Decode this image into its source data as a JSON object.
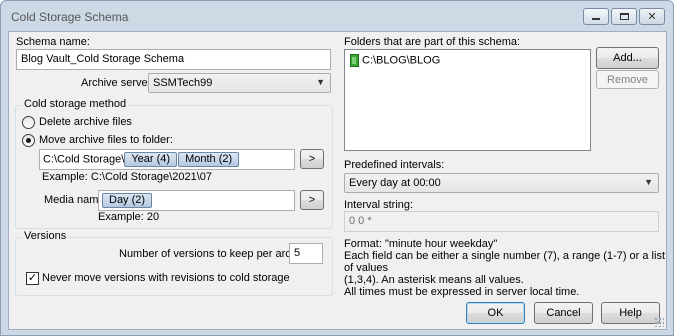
{
  "window": {
    "title": "Cold Storage Schema",
    "minimize_icon": "minimize-icon",
    "maximize_icon": "maximize-icon",
    "close_icon": "close-icon"
  },
  "schema_name": {
    "label": "Schema name:",
    "value": "Blog Vault_Cold Storage Schema"
  },
  "archive_server": {
    "label": "Archive server:",
    "value": "SSMTech99"
  },
  "cold_storage_method": {
    "title": "Cold storage method",
    "option_delete": "Delete archive files",
    "option_move": "Move archive files to folder:",
    "selected": "move",
    "folder_prefix": "C:\\Cold Storage\\",
    "folder_tokens": [
      "Year (4)",
      "Month (2)"
    ],
    "folder_insert_button": ">",
    "folder_example": "Example: C:\\Cold Storage\\2021\\07",
    "media_name_label": "Media name:",
    "media_tokens": [
      "Day (2)"
    ],
    "media_insert_button": ">",
    "media_example": "Example: 20"
  },
  "versions": {
    "title": "Versions",
    "keep_label": "Number of versions to keep per archive:",
    "keep_value": "5",
    "never_move_label": "Never move versions with revisions to cold storage",
    "never_move_checked": true
  },
  "folders": {
    "label": "Folders that are part of this schema:",
    "items": [
      "C:\\BLOG\\BLOG"
    ],
    "add_button": "Add...",
    "remove_button": "Remove"
  },
  "intervals": {
    "predefined_label": "Predefined intervals:",
    "predefined_value": "Every day at 00:00",
    "interval_string_label": "Interval string:",
    "interval_string_value": "0 0 *",
    "format_lines": [
      "Format: \"minute hour weekday\"",
      "Each field can be either a single number (7), a range (1-7) or a list of values",
      "(1,3,4). An asterisk means all values.",
      "All times must be expressed in server local time."
    ]
  },
  "footer": {
    "ok_button": "OK",
    "cancel_button": "Cancel",
    "help_button": "Help"
  }
}
